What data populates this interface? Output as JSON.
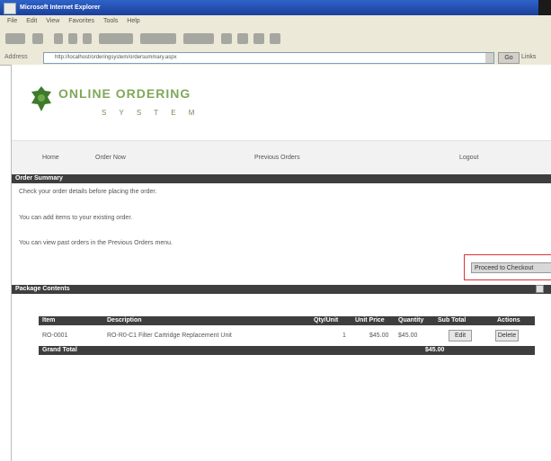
{
  "window": {
    "title": "Microsoft Internet Explorer"
  },
  "menu": [
    "File",
    "Edit",
    "View",
    "Favorites",
    "Tools",
    "Help"
  ],
  "address": {
    "label": "Address",
    "url": "http://localhost/orderingsystem/ordersummary.aspx",
    "go_label": "Go",
    "links_label": "Links"
  },
  "logo": {
    "line1": "ONLINE ORDERING",
    "line2": "S Y S T E M"
  },
  "nav": [
    "Home",
    "Order Now",
    "Previous Orders",
    "Logout"
  ],
  "sections": {
    "instructions_title": "Order Summary",
    "bullets": [
      "Check your order details before placing the order.",
      "You can add items to your existing order.",
      "You can view past orders in the Previous Orders menu."
    ],
    "recalc_label": "Proceed to Checkout",
    "package_title": "Package Contents"
  },
  "table": {
    "headers": [
      "Item",
      "Description",
      "Qty/Unit",
      "Unit Price",
      "Quantity",
      "Sub Total",
      "Actions"
    ],
    "rows": [
      {
        "item": "RO-0001",
        "description": "RO-R0-C1 Filter Cartridge Replacement Unit",
        "qty": "1",
        "price": "$45.00",
        "quantity": "$45.00",
        "edit": "Edit",
        "delete": "Delete"
      }
    ],
    "footer_label": "Grand Total",
    "footer_value": "$45.00"
  }
}
